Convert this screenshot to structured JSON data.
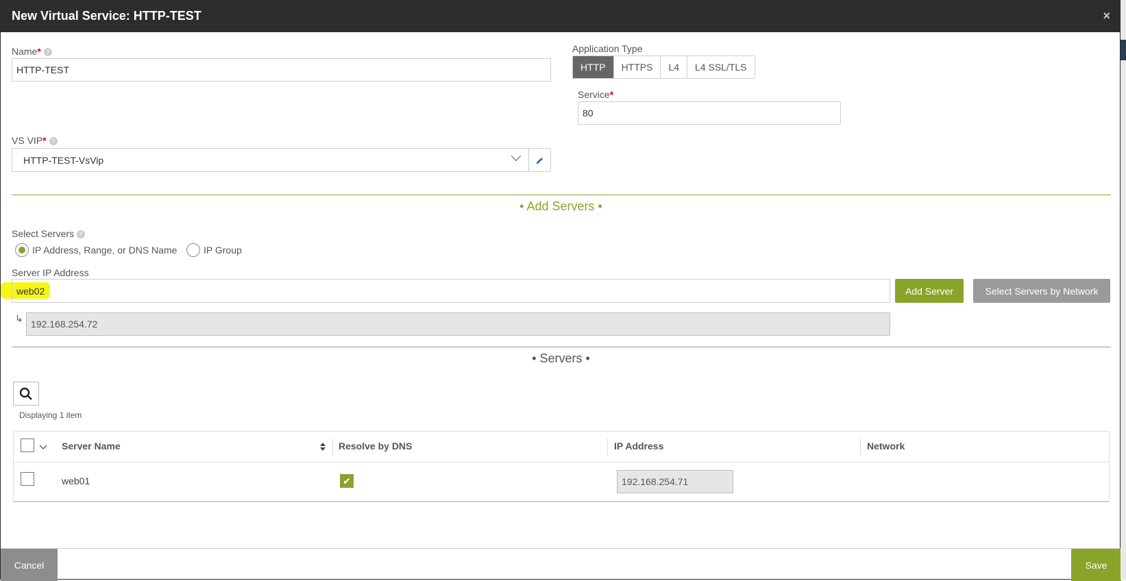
{
  "modal": {
    "title": "New Virtual Service: HTTP-TEST",
    "close_icon": "×"
  },
  "name_field": {
    "label": "Name",
    "value": "HTTP-TEST"
  },
  "application_type": {
    "label": "Application Type",
    "options": [
      "HTTP",
      "HTTPS",
      "L4",
      "L4 SSL/TLS"
    ],
    "selected": "HTTP"
  },
  "service_field": {
    "label": "Service",
    "value": "80"
  },
  "vs_vip": {
    "label": "VS VIP",
    "value": "HTTP-TEST-VsVip"
  },
  "add_servers": {
    "section_title": "• Add Servers •",
    "select_servers_label": "Select Servers",
    "radio_options": [
      "IP Address, Range, or DNS Name",
      "IP Group"
    ],
    "selected_option": "IP Address, Range, or DNS Name",
    "server_ip_label": "Server IP Address",
    "server_ip_value": "web02",
    "resolved_ip": "192.168.254.72",
    "resolved_arrow": "↳",
    "add_server_button": "Add Server",
    "select_by_network_button": "Select Servers by Network"
  },
  "servers": {
    "section_title": "• Servers •",
    "displaying_text": "Displaying 1 item",
    "columns": [
      "Server Name",
      "Resolve by DNS",
      "IP Address",
      "Network"
    ],
    "rows": [
      {
        "server_name": "web01",
        "resolve_by_dns": true,
        "ip_address": "192.168.254.71",
        "network": ""
      }
    ]
  },
  "footer": {
    "cancel_label": "Cancel",
    "save_label": "Save"
  },
  "colors": {
    "accent": "#8aa42a",
    "titlebar": "#2d2d2d",
    "highlight": "#f5f500"
  }
}
